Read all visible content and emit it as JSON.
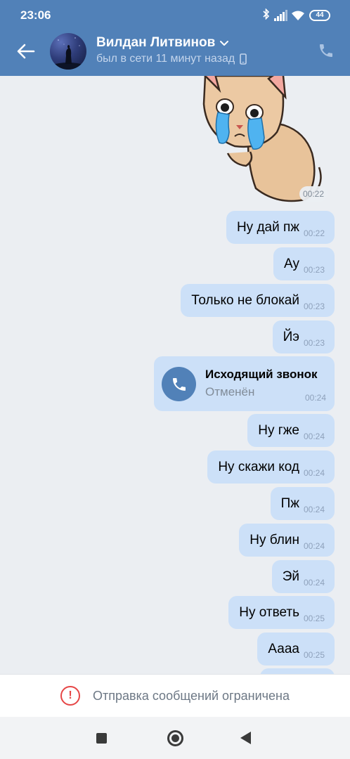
{
  "status_bar": {
    "time": "23:06",
    "battery": "44",
    "icons": [
      "bluetooth-icon",
      "signal-icon",
      "wifi-icon",
      "battery-icon"
    ]
  },
  "header": {
    "contact_name": "Вилдан Литвинов",
    "status": "был в сети 11 минут назад",
    "icons": [
      "back-arrow-icon",
      "chevron-down-icon",
      "mobile-device-icon",
      "phone-icon"
    ]
  },
  "messages": [
    {
      "type": "sticker",
      "description_icon": "crying-cat-sticker",
      "time": "00:22"
    },
    {
      "type": "text",
      "text": "Ну дай пж",
      "time": "00:22"
    },
    {
      "type": "text",
      "text": "Ау",
      "time": "00:23"
    },
    {
      "type": "text",
      "text": "Только не блокай",
      "time": "00:23"
    },
    {
      "type": "text",
      "text": "Йэ",
      "time": "00:23"
    },
    {
      "type": "call",
      "title": "Исходящий звонок",
      "subtitle": "Отменён",
      "time": "00:24"
    },
    {
      "type": "text",
      "text": "Ну гже",
      "time": "00:24"
    },
    {
      "type": "text",
      "text": "Ну скажи код",
      "time": "00:24"
    },
    {
      "type": "text",
      "text": "Пж",
      "time": "00:24"
    },
    {
      "type": "text",
      "text": "Ну блин",
      "time": "00:24"
    },
    {
      "type": "text",
      "text": "Эй",
      "time": "00:24"
    },
    {
      "type": "text",
      "text": "Ну ответь",
      "time": "00:25"
    },
    {
      "type": "text",
      "text": "Аааа",
      "time": "00:25"
    }
  ],
  "notice": {
    "text": "Отправка сообщений ограничена",
    "icon": "warning-circle-icon"
  },
  "nav": {
    "icons": [
      "recent-apps-icon",
      "home-icon",
      "back-icon"
    ]
  },
  "colors": {
    "header": "#5181b8",
    "bubble": "#cce0f8",
    "chat_bg": "#ebeef2",
    "warning": "#e64646"
  }
}
